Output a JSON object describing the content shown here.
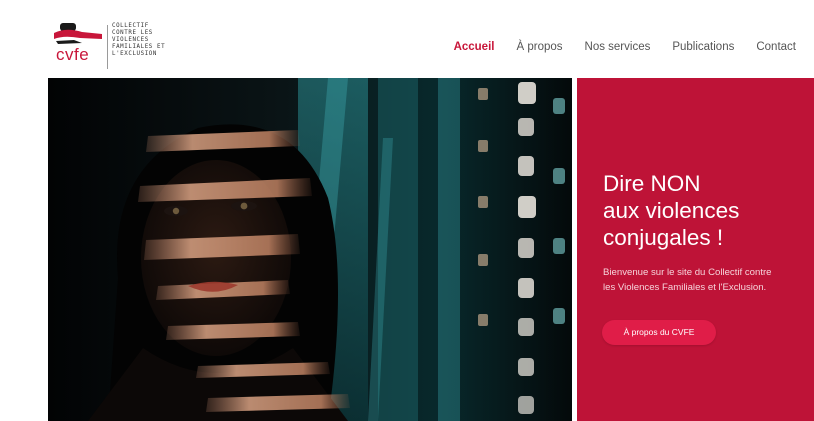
{
  "logo": {
    "wordmark": "cvfe",
    "tagline": [
      "COLLECTIF",
      "CONTRE LES",
      "VIOLENCES",
      "FAMILIALES ET",
      "L'EXCLUSION"
    ],
    "accent_color": "#c8163a"
  },
  "nav": {
    "items": [
      {
        "label": "Accueil",
        "active": true
      },
      {
        "label": "À propos",
        "active": false
      },
      {
        "label": "Nos services",
        "active": false
      },
      {
        "label": "Publications",
        "active": false
      },
      {
        "label": "Contact",
        "active": false
      }
    ],
    "active_color": "#c8163a"
  },
  "hero": {
    "title_lines": [
      "Dire NON",
      "aux violences",
      "conjugales !"
    ],
    "text_lines": [
      "Bienvenue sur le site du Collectif contre",
      "les Violences Familiales et l'Exclusion."
    ],
    "button_label": "À propos du CVFE",
    "panel_color": "#be1337",
    "button_color": "#e01d48"
  }
}
